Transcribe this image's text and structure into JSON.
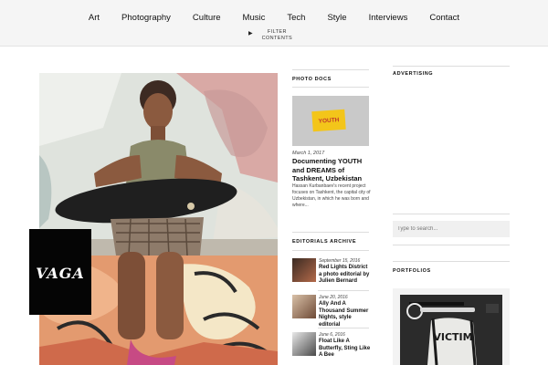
{
  "nav": {
    "items": [
      "Art",
      "Photography",
      "Culture",
      "Music",
      "Tech",
      "Style",
      "Interviews",
      "Contact"
    ],
    "filter_line1": "FILTER",
    "filter_line2": "CONTENTS"
  },
  "hero": {
    "logo_text": "VAGA"
  },
  "photo_docs": {
    "heading": "PHOTO DOCS",
    "thumb_tag": "YOUTH",
    "date": "March 1, 2017",
    "title": "Documenting YOUTH and DREAMS of Tashkent, Uzbekistan",
    "excerpt": "Hassan Kurbanbaev's recent project focuses on Tashkent, the capital city of Uzbekistan, in which he was born and where..."
  },
  "editorials": {
    "heading": "EDITORIALS ARCHIVE",
    "items": [
      {
        "date": "September 15, 2016",
        "title": "Red Lights District a photo editorial by Julien Bernard"
      },
      {
        "date": "June 20, 2016",
        "title": "Ally And A Thousand Summer Nights, style editorial"
      },
      {
        "date": "June 6, 2016",
        "title": "Float Like A Butterfly, Sting Like A Bee"
      }
    ]
  },
  "sidebar": {
    "advertising_heading": "ADVERTISING",
    "search_placeholder": "Type to search...",
    "portfolios_heading": "PORTFOLIOS",
    "portfolio_text": "VICTIM"
  },
  "colors": {
    "accent_yellow": "#f3c51a",
    "topbar_bg": "#f5f5f5"
  }
}
